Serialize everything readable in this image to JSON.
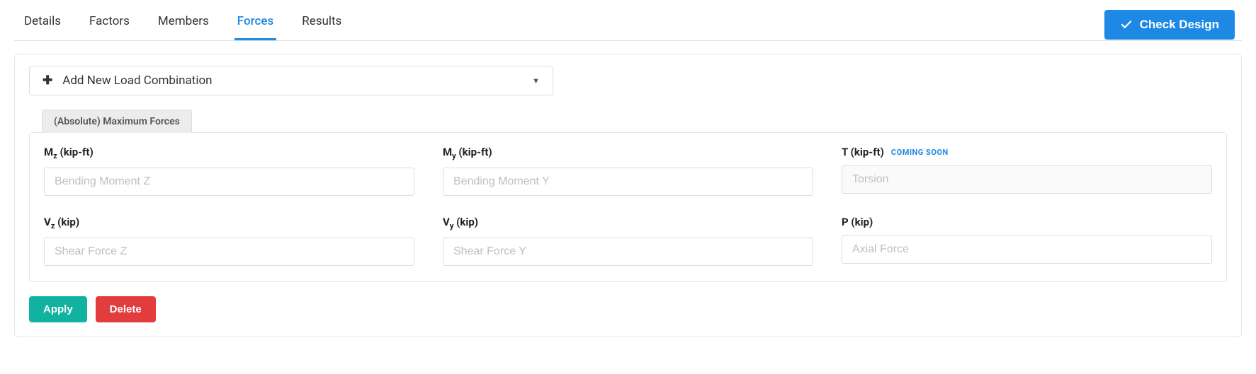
{
  "tabs": {
    "details": "Details",
    "factors": "Factors",
    "members": "Members",
    "forces": "Forces",
    "results": "Results"
  },
  "check_design_label": "Check Design",
  "add_combo_label": "Add New Load Combination",
  "subtab_label": "(Absolute) Maximum Forces",
  "fields": {
    "mz": {
      "label_main": "M",
      "label_sub": "z",
      "label_unit": " (kip-ft)",
      "placeholder": "Bending Moment Z"
    },
    "my": {
      "label_main": "M",
      "label_sub": "y",
      "label_unit": " (kip-ft)",
      "placeholder": "Bending Moment Y"
    },
    "t": {
      "label_main": "T (kip-ft)",
      "placeholder": "Torsion",
      "coming_soon": "COMING SOON"
    },
    "vz": {
      "label_main": "V",
      "label_sub": "z",
      "label_unit": " (kip)",
      "placeholder": "Shear Force Z"
    },
    "vy": {
      "label_main": "V",
      "label_sub": "y",
      "label_unit": " (kip)",
      "placeholder": "Shear Force Y"
    },
    "p": {
      "label_main": "P (kip)",
      "placeholder": "Axial Force"
    }
  },
  "buttons": {
    "apply": "Apply",
    "delete": "Delete"
  }
}
